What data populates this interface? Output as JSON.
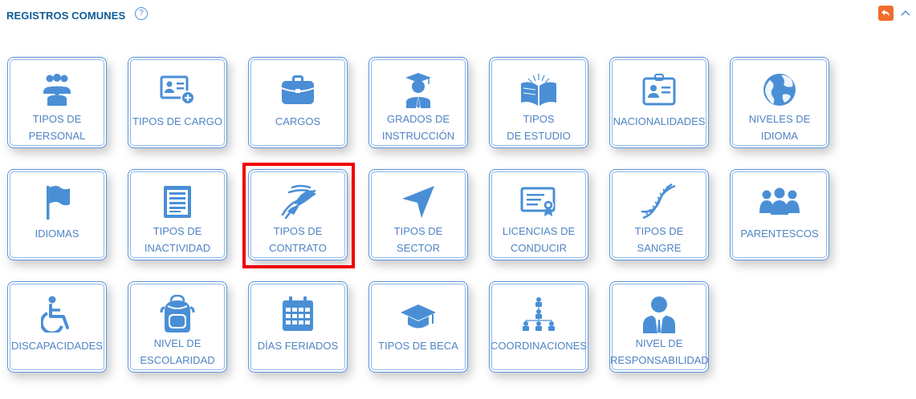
{
  "header": {
    "title": "REGISTROS COMUNES",
    "help_glyph": "?"
  },
  "colors": {
    "accent": "#4a8fd6",
    "card_border": "#5f97dc",
    "label": "#4f84c4",
    "title": "#0f5b96",
    "back_button": "#f26c2b",
    "highlight": "#f00000"
  },
  "cards": [
    {
      "label": "TIPOS DE\nPERSONAL",
      "icon": "users-group-icon"
    },
    {
      "label": "TIPOS DE CARGO",
      "icon": "id-card-add-icon"
    },
    {
      "label": "CARGOS",
      "icon": "briefcase-icon"
    },
    {
      "label": "GRADOS DE\nINSTRUCCIÓN",
      "icon": "graduate-icon"
    },
    {
      "label": "TIPOS\nDE ESTUDIO",
      "icon": "open-book-icon"
    },
    {
      "label": "NACIONALIDADES",
      "icon": "badge-icon"
    },
    {
      "label": "NIVELES DE\nIDIOMA",
      "icon": "globe-icon"
    },
    {
      "label": "IDIOMAS",
      "icon": "flag-icon"
    },
    {
      "label": "TIPOS DE\nINACTIVIDAD",
      "icon": "document-list-icon"
    },
    {
      "label": "TIPOS DE\nCONTRATO",
      "icon": "handshake-icon"
    },
    {
      "label": "TIPOS DE\nSECTOR",
      "icon": "navigation-arrow-icon"
    },
    {
      "label": "LICENCIAS DE\nCONDUCIR",
      "icon": "certificate-icon"
    },
    {
      "label": "TIPOS DE\nSANGRE",
      "icon": "dna-icon"
    },
    {
      "label": "PARENTESCOS",
      "icon": "family-icon"
    },
    {
      "label": "DISCAPACIDADES",
      "icon": "wheelchair-icon"
    },
    {
      "label": "NIVEL DE\nESCOLARIDAD",
      "icon": "backpack-icon"
    },
    {
      "label": "DÍAS FERIADOS",
      "icon": "calendar-icon"
    },
    {
      "label": "TIPOS DE BECA",
      "icon": "mortarboard-icon"
    },
    {
      "label": "COORDINACIONES",
      "icon": "org-chart-icon"
    },
    {
      "label": "NIVEL DE\nRESPONSABILIDAD",
      "icon": "businessman-icon"
    }
  ],
  "selected_card": "TIPOS DE\nCONTRATO"
}
